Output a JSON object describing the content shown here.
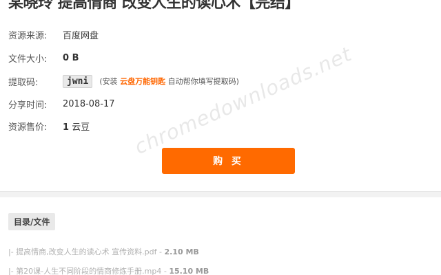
{
  "page": {
    "title": "某晓玲 提高情商 改变人生的读心术【完结】"
  },
  "info": {
    "source": {
      "label": "资源来源:",
      "value": "百度网盘"
    },
    "size": {
      "label": "文件大小:",
      "value": "0 B"
    },
    "code": {
      "label": "提取码:",
      "value": "jwni",
      "hint_prefix": "(安装",
      "hint_link": "云盘万能钥匙",
      "hint_suffix": "自动帮你填写提取码)"
    },
    "share_time": {
      "label": "分享时间:",
      "value": "2018-08-17"
    },
    "price": {
      "label": "资源售价:",
      "amount": "1",
      "unit": "云豆"
    }
  },
  "buy_button": {
    "label": "购 买"
  },
  "directory": {
    "tab_label": "目录/文件",
    "files": [
      {
        "name": "|- 提高情商,改变人生的读心术 宣传资料.pdf",
        "separator": " - ",
        "size": "2.10 MB"
      },
      {
        "name": "|- 第20课-人生不同阶段的情商修炼手册.mp4",
        "separator": " - ",
        "size": "15.10 MB"
      }
    ]
  },
  "watermark": {
    "text": "chromedownloads.net"
  },
  "colors": {
    "accent": "#ff6a00",
    "divider": "#f2f2f2",
    "tag_bg": "#e9e9e9"
  }
}
